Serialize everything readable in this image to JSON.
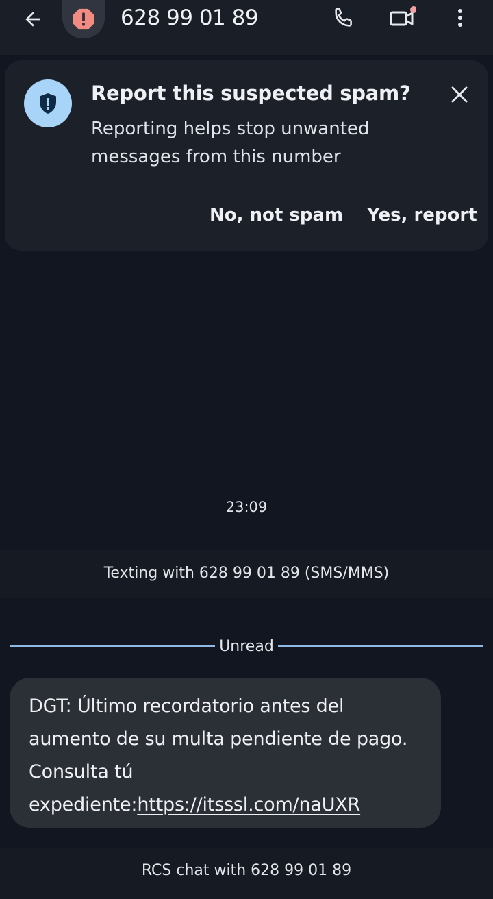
{
  "header": {
    "contact_name": "628 99 01 89",
    "icons": {
      "back": "arrow-back-icon",
      "avatar": "spam-alert-icon",
      "call": "phone-icon",
      "video": "video-camera-icon",
      "more": "more-vert-icon"
    }
  },
  "spam_card": {
    "title": "Report this suspected spam?",
    "description": "Reporting helps stop unwanted messages from this number",
    "no_label": "No, not spam",
    "yes_label": "Yes, report",
    "icons": {
      "shield": "shield-icon",
      "close": "close-icon"
    }
  },
  "conversation": {
    "timestamp": "23:09",
    "texting_info": "Texting with 628 99 01 89 (SMS/MMS)",
    "unread_label": "Unread",
    "message": {
      "text": "DGT: Último recordatorio antes del aumento de su multa pendiente de pago. Consulta tú expediente:",
      "link": "https://itsssl.com/naUXR"
    }
  },
  "footer": {
    "rcs_info": "RCS chat with 628 99 01 89"
  },
  "colors": {
    "background": "#111620",
    "app_bar": "#1a1f27",
    "card": "#1b2029",
    "bubble": "#2b2f36",
    "shield_badge": "#a8d4f7",
    "spam_avatar": "#f28b82",
    "divider": "#8fb9e3",
    "notification_dot": "#f2a0a0"
  }
}
